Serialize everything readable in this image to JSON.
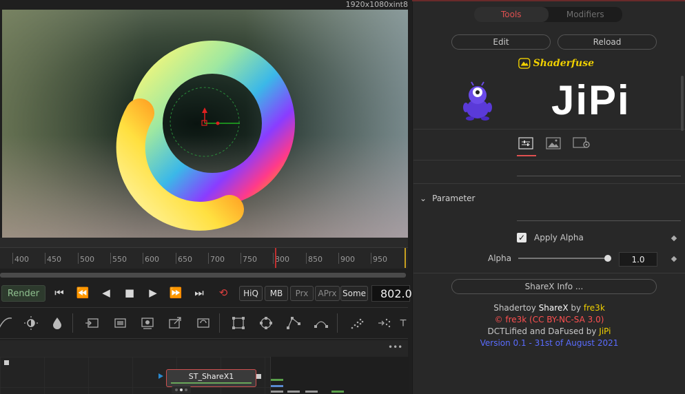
{
  "viewer": {
    "resolution": "1920x1080xint8"
  },
  "ruler": {
    "labels": [
      "400",
      "450",
      "500",
      "550",
      "600",
      "650",
      "700",
      "750",
      "800",
      "850",
      "900",
      "950"
    ]
  },
  "transport": {
    "render_label": "Render",
    "toggles": [
      {
        "label": "HiQ",
        "dim": false
      },
      {
        "label": "MB",
        "dim": false
      },
      {
        "label": "Prx",
        "dim": true
      },
      {
        "label": "APrx",
        "dim": true
      },
      {
        "label": "Some",
        "dim": false
      }
    ],
    "current_frame": "802.0"
  },
  "node": {
    "label": "ST_ShareX1"
  },
  "nodebar": {
    "menu_label": "•••"
  },
  "inspector": {
    "tabs": [
      {
        "label": "Tools",
        "active": true
      },
      {
        "label": "Modifiers",
        "active": false
      }
    ],
    "edit_label": "Edit",
    "reload_label": "Reload",
    "shaderfuse_label": "Shaderfuse",
    "fuse_title": "JiPi",
    "section_title": "Parameter",
    "apply_alpha_label": "Apply Alpha",
    "alpha_label": "Alpha",
    "alpha_value": "1.0",
    "alpha_level": 1.0,
    "info_button": "ShareX Info ...",
    "credits": {
      "line1_prefix": "Shadertoy ",
      "line1_name": "ShareX",
      "line1_by": " by ",
      "line1_author": "fre3k",
      "line2": "© fre3k (CC BY-NC-SA 3.0)",
      "line3_prefix": "DCTLified and DaFused by ",
      "line3_author": "JiPi",
      "line4": "Version 0.1 - 31st of August 2021"
    }
  },
  "colors": {
    "accent_red": "#e05050",
    "author_yellow": "#f0d000",
    "license_red": "#ff5050",
    "version_blue": "#5a6cff",
    "render_green": "#8fc08f"
  }
}
